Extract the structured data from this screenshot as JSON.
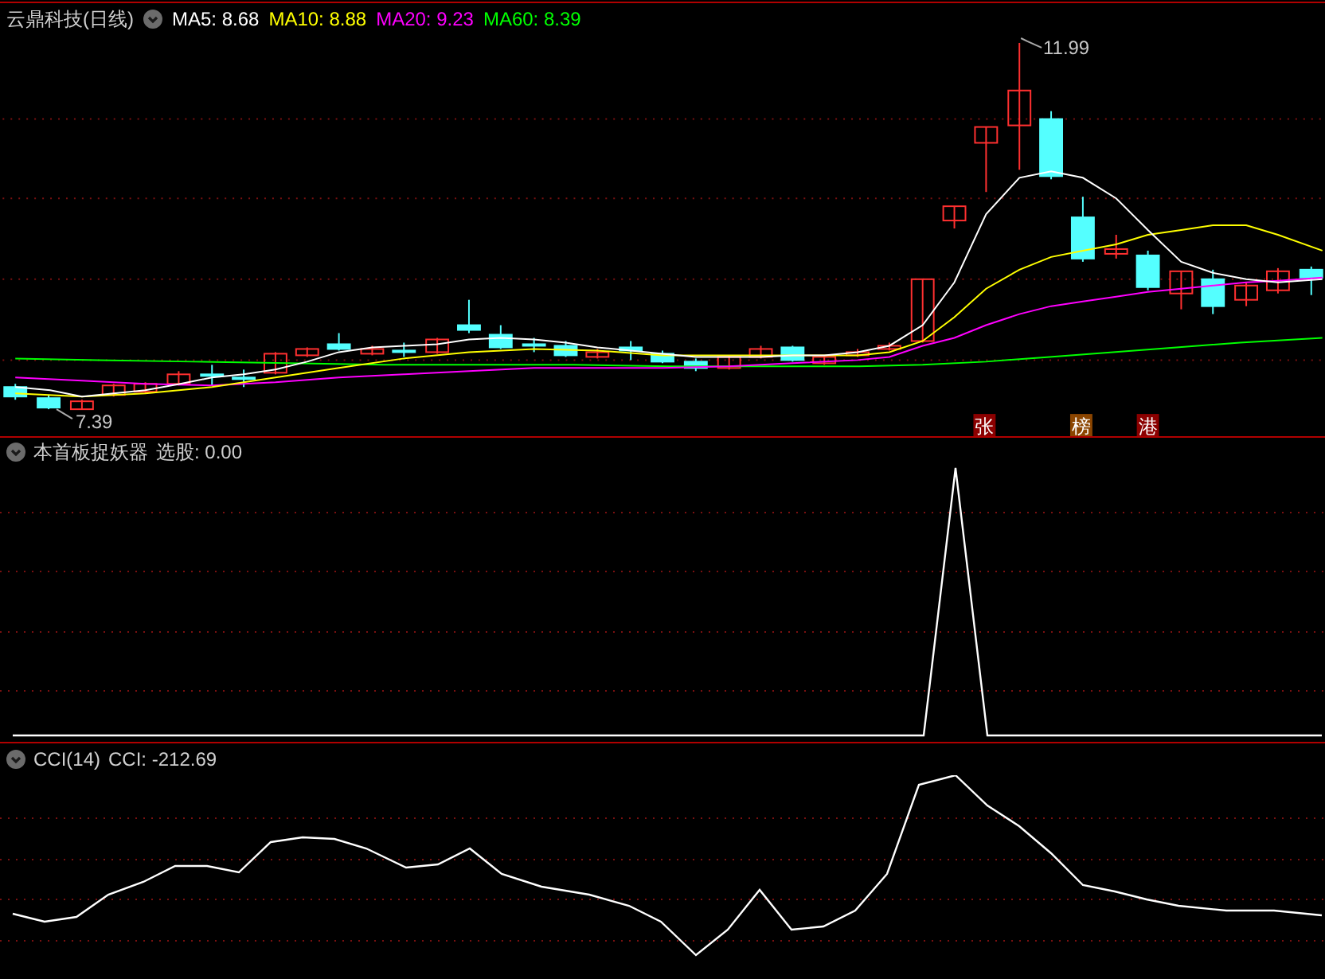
{
  "main_panel": {
    "title": "云鼎科技(日线)",
    "indicators": [
      {
        "label": "MA5: 8.68",
        "color": "#ffffff"
      },
      {
        "label": "MA10: 8.88",
        "color": "#ffff00"
      },
      {
        "label": "MA20: 9.23",
        "color": "#ff00ff"
      },
      {
        "label": "MA60: 8.39",
        "color": "#00ff00"
      }
    ],
    "high_label": "11.99",
    "low_label": "7.39",
    "event_markers": [
      {
        "label": "张",
        "color": "#8b0000"
      },
      {
        "label": "榜",
        "color": "#8b4500"
      },
      {
        "label": "港",
        "color": "#8b0000"
      }
    ]
  },
  "signal_panel": {
    "title": "本首板捉妖器",
    "reading": "选股: 0.00"
  },
  "cci_panel": {
    "title": "CCI(14)",
    "reading": "CCI: -212.69"
  }
}
